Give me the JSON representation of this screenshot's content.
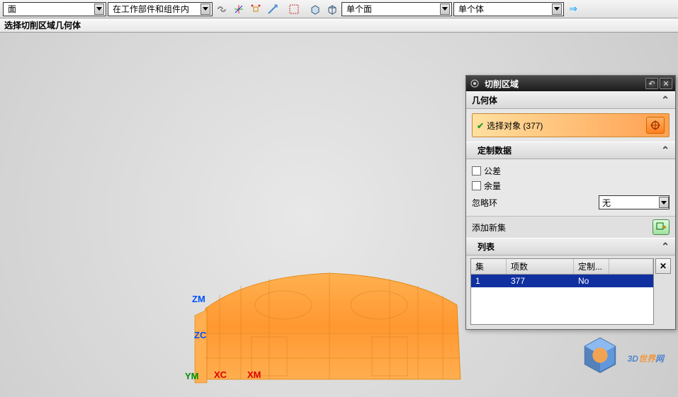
{
  "toolbar": {
    "combo1": "面",
    "combo2": "在工作部件和组件内",
    "combo3": "单个面",
    "combo4": "单个体"
  },
  "status_text": "选择切削区域几何体",
  "axes": {
    "zm": "ZM",
    "zc": "ZC",
    "ym": "YM",
    "xc": "XC",
    "xm": "XM"
  },
  "dialog": {
    "title": "切削区域",
    "geom_header": "几何体",
    "select_label": "选择对象 (377)",
    "custom_header": "定制数据",
    "chk1": "公差",
    "chk2": "余量",
    "ignore_loop": "忽略环",
    "ignore_value": "无",
    "add_new": "添加新集",
    "list_header": "列表",
    "cols": {
      "c1": "集",
      "c2": "项数",
      "c3": "定制...",
      "c4": ""
    },
    "row": {
      "c1": "1",
      "c2": "377",
      "c3": "No",
      "c4": ""
    }
  },
  "watermark": {
    "a": "3D",
    "b": "世界",
    "c": "网"
  }
}
